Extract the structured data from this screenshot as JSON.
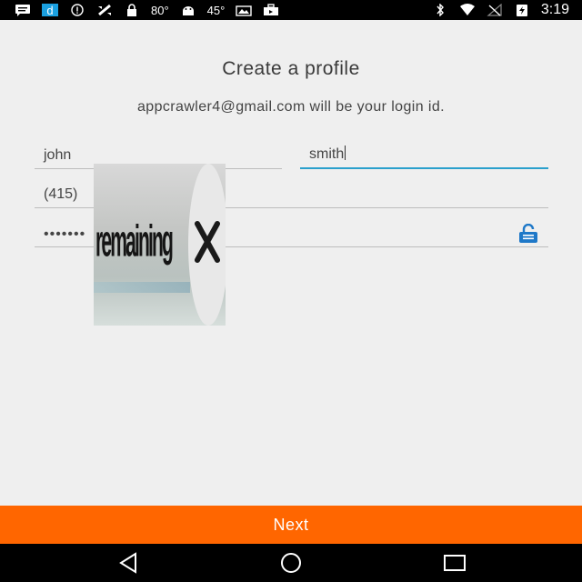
{
  "status_bar": {
    "battery_temp": "80°",
    "cpu_temp": "45°",
    "time": "3:19",
    "left_icons": [
      "message-icon",
      "app-d-icon",
      "info-icon",
      "satellite-icon",
      "lock-icon",
      "temperature-text",
      "android-icon",
      "temperature-text",
      "photo-icon",
      "briefcase-icon"
    ],
    "right_icons": [
      "bluetooth-icon",
      "wifi-icon",
      "no-signal-icon",
      "battery-charging-icon"
    ]
  },
  "page": {
    "title": "Create a profile",
    "subtitle": "appcrawler4@gmail.com will be your login id."
  },
  "form": {
    "first_name": "john",
    "last_name": "smith",
    "phone": "(415)",
    "password": "•••••••"
  },
  "overlay": {
    "text": "remaining"
  },
  "actions": {
    "next_label": "Next"
  },
  "colors": {
    "accent": "#ff6600",
    "focus": "#2aa0cc",
    "lock_icon": "#1e78c8",
    "background": "#efefef"
  }
}
